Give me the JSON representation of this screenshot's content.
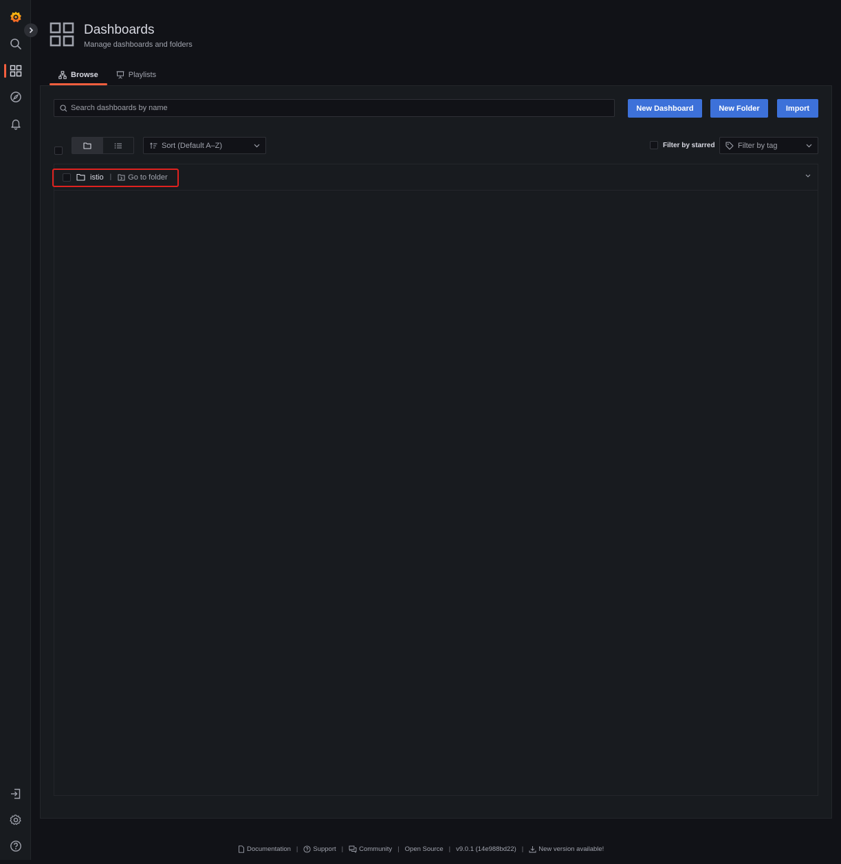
{
  "header": {
    "title": "Dashboards",
    "subtitle": "Manage dashboards and folders"
  },
  "tabs": [
    {
      "label": "Browse",
      "icon": "sitemap-icon",
      "active": true
    },
    {
      "label": "Playlists",
      "icon": "presentation-icon",
      "active": false
    }
  ],
  "search": {
    "placeholder": "Search dashboards by name",
    "value": ""
  },
  "actions": {
    "new_dashboard": "New Dashboard",
    "new_folder": "New Folder",
    "import": "Import"
  },
  "sort": {
    "selected": "Sort (Default A–Z)"
  },
  "filters": {
    "starred_label": "Filter by starred",
    "tag_placeholder": "Filter by tag"
  },
  "folders": [
    {
      "name": "istio",
      "goto_label": "Go to folder"
    }
  ],
  "sidebar": {
    "icons": [
      "grafana-logo",
      "search-icon",
      "dashboards-icon",
      "explore-icon",
      "alert-bell-icon",
      "sign-in-icon",
      "gear-icon",
      "help-icon"
    ],
    "active": "dashboards-icon"
  },
  "footer": {
    "documentation": "Documentation",
    "support": "Support",
    "community": "Community",
    "open_source": "Open Source",
    "version": "v9.0.1 (14e988bd22)",
    "new_version": "New version available!"
  },
  "colors": {
    "accent": "#f55f3e",
    "primary_button": "#3d71d9",
    "highlight": "#e0221f"
  }
}
